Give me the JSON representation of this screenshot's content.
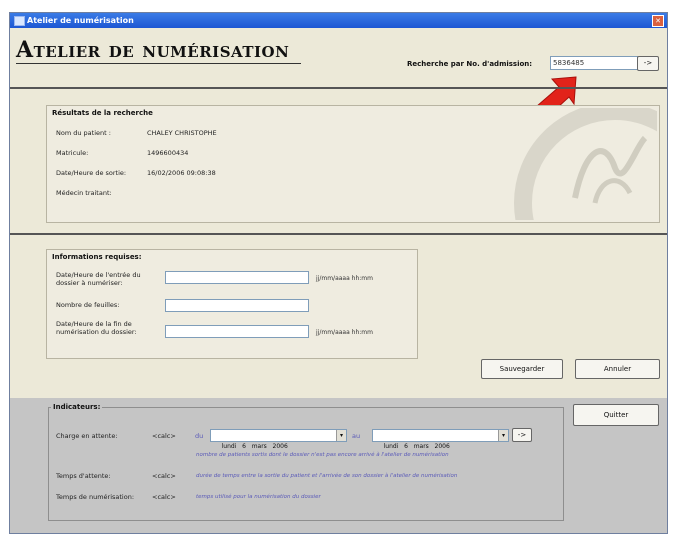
{
  "window": {
    "title": "Atelier de numérisation"
  },
  "page_title": "Atelier de numérisation",
  "search": {
    "label": "Recherche par No. d'admission:",
    "value": "5836485",
    "go_label": "->"
  },
  "results": {
    "legend": "Résultats de la recherche",
    "rows": [
      {
        "label": "Nom du patient :",
        "value": "CHALEY CHRISTOPHE"
      },
      {
        "label": "Matricule:",
        "value": "1496600434"
      },
      {
        "label": "Date/Heure de sortie:",
        "value": "16/02/2006 09:08:38"
      },
      {
        "label": "Médecin traitant:",
        "value": ""
      }
    ]
  },
  "form": {
    "legend": "Informations requises:",
    "start_label": "Date/Heure de l'entrée du dossier à numériser:",
    "start_hint": "jj/mm/aaaa hh:mm",
    "sheets_label": "Nombre de feuilles:",
    "end_label": "Date/Heure de la fin de numérisation du dossier:",
    "end_hint": "jj/mm/aaaa hh:mm"
  },
  "buttons": {
    "save": "Sauvegarder",
    "cancel": "Annuler",
    "quit": "Quitter"
  },
  "indicators": {
    "legend": "Indicateurs:",
    "waiting_label": "Charge en attente:",
    "waiting_value": "<calc>",
    "from_label": "du",
    "to_label": "au",
    "from_date": {
      "weekday": "lundi",
      "day": "6",
      "month": "mars",
      "year": "2006"
    },
    "to_date": {
      "weekday": "lundi",
      "day": "6",
      "month": "mars",
      "year": "2006"
    },
    "go_label": "->",
    "waiting_note": "nombre de patients sortis dont le dossier n'est pas encore arrivé à l'atelier de numérisation",
    "wait_time_label": "Temps d'attente:",
    "wait_time_value": "<calc>",
    "wait_time_note": "durée de temps entre la sortie du patient et l'arrivée de son dossier à l'atelier de numérisation",
    "scan_time_label": "Temps de numérisation:",
    "scan_time_value": "<calc>",
    "scan_time_note": "temps utilisé pour la numérisation du dossier"
  },
  "colors": {
    "highlight_arrow": "#e2231a",
    "titlebar": "#1c56d3",
    "bottom_panel": "#c5c5c5"
  }
}
